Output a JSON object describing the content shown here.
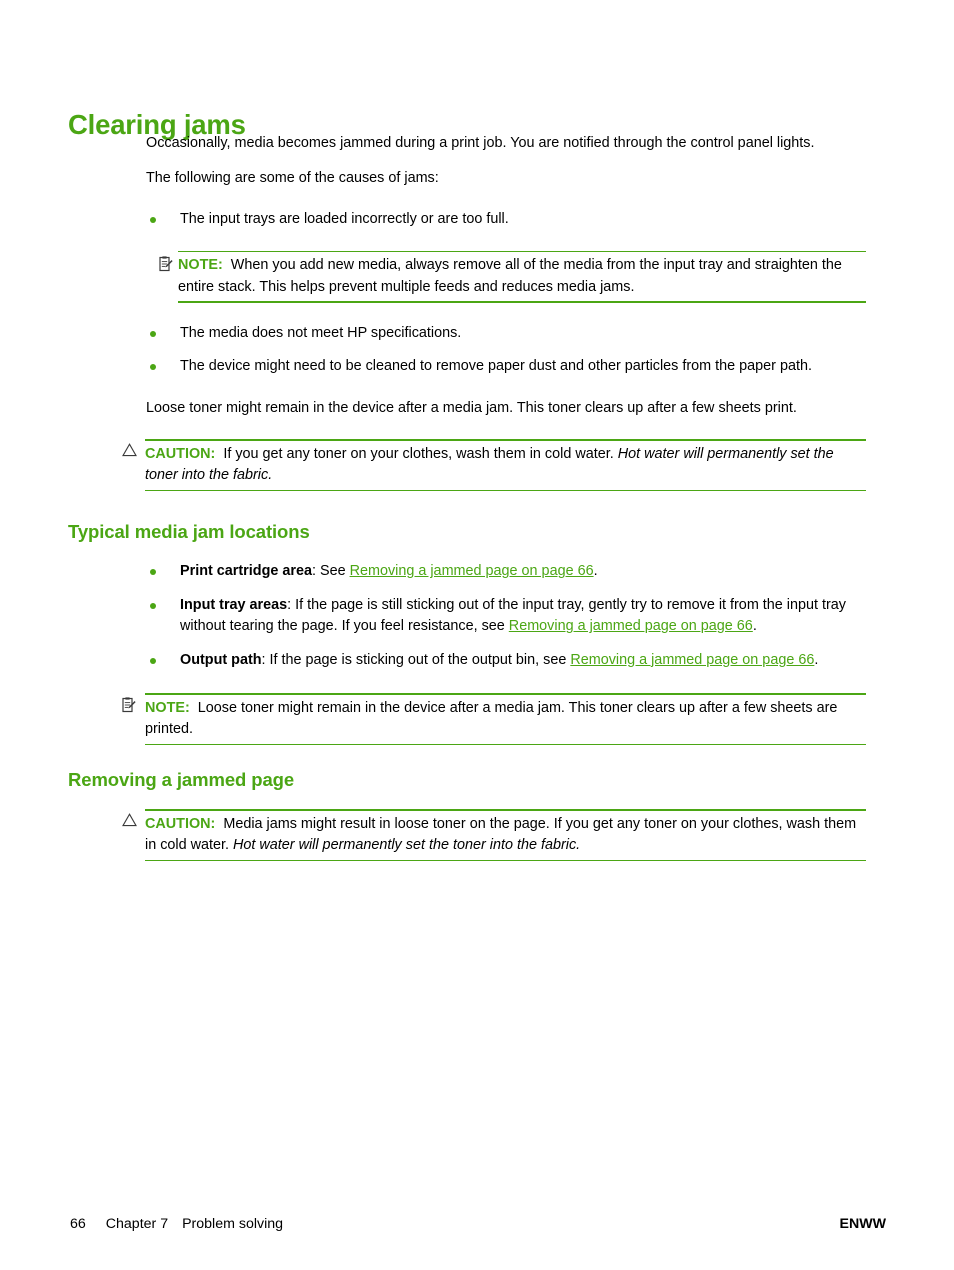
{
  "document": {
    "title": "Clearing jams",
    "accent_color": "#4ba614",
    "text_color": "#000000",
    "background_color": "#ffffff"
  },
  "headings": {
    "h1": "Clearing jams",
    "h2_typical": "Typical media jam locations",
    "h2_removing": "Removing a jammed page"
  },
  "intro": {
    "paragraph_1": "Occasionally, media becomes jammed during a print job. You are notified through the control panel lights.",
    "paragraph_2": "The following are some of the causes of jams:"
  },
  "causes": {
    "bullet_1": "The input trays are loaded incorrectly or are too full.",
    "bullet_2": "The media does not meet HP specifications.",
    "bullet_3": "The device might need to be cleaned to remove paper dust and other particles from the paper path."
  },
  "note_1": {
    "icon": "note-clipboard-icon",
    "label": "NOTE:",
    "text": "When you add new media, always remove all of the media from the input tray and straighten the entire stack. This helps prevent multiple feeds and reduces media jams."
  },
  "loose_toner_paragraph": "Loose toner might remain in the device after a media jam. This toner clears up after a few sheets print.",
  "caution_1": {
    "icon": "warning-triangle-icon",
    "label": "CAUTION:",
    "text": "If you get any toner on your clothes, wash them in cold water.",
    "emphasis": "Hot water will permanently set the toner into the fabric."
  },
  "jam_locations": {
    "item_1": {
      "term": "Print cartridge area",
      "text_before": ": See ",
      "link": "Removing a jammed page on page 66",
      "text_after": "."
    },
    "item_2": {
      "term": "Input tray areas",
      "text_before": ": If the page is still sticking out of the input tray, gently try to remove it from the input tray without tearing the page. If you feel resistance, see ",
      "link": "Removing a jammed page on page 66",
      "text_after": "."
    },
    "item_3": {
      "term": "Output path",
      "text_before": ": If the page is sticking out of the output bin, see ",
      "link": "Removing a jammed page on page 66",
      "text_after": "."
    }
  },
  "note_2": {
    "icon": "note-clipboard-icon",
    "label": "NOTE:",
    "text": "Loose toner might remain in the device after a media jam. This toner clears up after a few sheets are printed."
  },
  "caution_2": {
    "icon": "warning-triangle-icon",
    "label": "CAUTION:",
    "text": "Media jams might result in loose toner on the page. If you get any toner on your clothes, wash them in cold water.",
    "emphasis": "Hot water will permanently set the toner into the fabric."
  },
  "footer": {
    "page_number": "66",
    "chapter": "Chapter 7",
    "chapter_title": "Problem solving",
    "locale": "ENWW"
  }
}
